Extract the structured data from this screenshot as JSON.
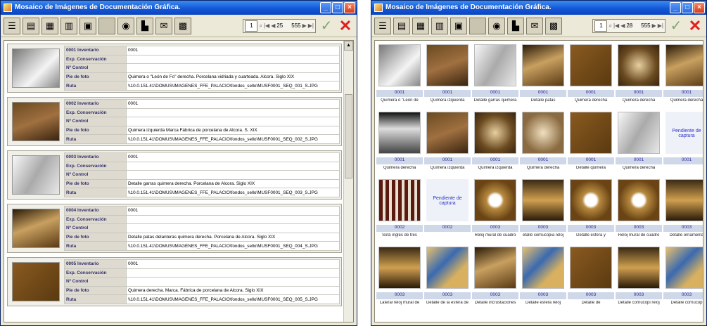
{
  "window_list": {
    "title": "Mosaico de Imágenes de Documentación Gráfica.",
    "nav": {
      "current": "1",
      "count": "25",
      "total": "555"
    },
    "labels": {
      "inventario": "Inventario",
      "conservacion": "Exp. Conservación",
      "control": "Nº Control",
      "pie": "Pie de foto",
      "ruta": "Ruta"
    },
    "records": [
      {
        "num": "0001",
        "inventario": "0001",
        "pie": "Quimera o \"León de Fo\" derecha. Porcelana vidriada y cuarteada. Alcora. Siglo XIX",
        "ruta": "\\\\10.0.151.41\\DOMUS\\IMAGENES_FFE_PALACIO\\fondos_sello\\MUSF0001_SEQ_001_S.JPG"
      },
      {
        "num": "0002",
        "inventario": "0001",
        "pie": "Quimera izquierda Marca Fábrica de porcelana de Alcora. S. XIX",
        "ruta": "\\\\10.0.151.41\\DOMUS\\IMAGENES_FFE_PALACIO\\fondos_sello\\MUSF0001_SEQ_002_S.JPG"
      },
      {
        "num": "0003",
        "inventario": "0001",
        "pie": "Detalle garras quimera derecha. Porcelana de Alcora. Siglo XIX",
        "ruta": "\\\\10.0.151.41\\DOMUS\\IMAGENES_FFE_PALACIO\\fondos_sello\\MUSF0001_SEQ_003_S.JPG"
      },
      {
        "num": "0004",
        "inventario": "0001",
        "pie": "Detalle patas delanteras quimera derecha. Porcelana de Alcora. Siglo XIX",
        "ruta": "\\\\10.0.151.41\\DOMUS\\IMAGENES_FFE_PALACIO\\fondos_sello\\MUSF0001_SEQ_004_S.JPG"
      },
      {
        "num": "0005",
        "inventario": "0001",
        "pie": "Quimera derecha. Marca. Fábrica de porcelana de Alcora. Siglo XIX",
        "ruta": "\\\\10.0.151.41\\DOMUS\\IMAGENES_FFE_PALACIO\\fondos_sello\\MUSF0001_SEQ_005_S.JPG"
      }
    ]
  },
  "window_grid": {
    "title": "Mosaico de Imágenes de Documentación Gráfica.",
    "nav": {
      "current": "1",
      "count": "28",
      "total": "555"
    },
    "pending_label": "Pendiente de captura",
    "cells": [
      {
        "num": "0001",
        "cap": "Quimera o \"León de"
      },
      {
        "num": "0001",
        "cap": "Quimera izquierda"
      },
      {
        "num": "0001",
        "cap": "Detalle garras quimera"
      },
      {
        "num": "0001",
        "cap": "Detalle patas"
      },
      {
        "num": "0001",
        "cap": "Quimera derecha"
      },
      {
        "num": "0001",
        "cap": "Quimera derecha"
      },
      {
        "num": "0001",
        "cap": "Quimera derecha"
      },
      {
        "num": "0001",
        "cap": "Quimera derecha"
      },
      {
        "num": "0001",
        "cap": "Quimera izquierda"
      },
      {
        "num": "0001",
        "cap": "Quimera izquierda"
      },
      {
        "num": "0001",
        "cap": "Quimera derecha"
      },
      {
        "num": "0001",
        "cap": "Detalle quimera"
      },
      {
        "num": "0001",
        "cap": "Quimera derecha"
      },
      {
        "num": "0001",
        "cap": "",
        "pending": true
      },
      {
        "num": "0002",
        "cap": "Sofá inglés de tres"
      },
      {
        "num": "0002",
        "cap": "",
        "pending": true
      },
      {
        "num": "0003",
        "cap": "Reloj mural de cuadro"
      },
      {
        "num": "0003",
        "cap": "etalle cornucopia reloj"
      },
      {
        "num": "0003",
        "cap": "Detalle esfera y"
      },
      {
        "num": "0003",
        "cap": "Reloj mural de cuadro"
      },
      {
        "num": "0003",
        "cap": "Detalle ornamenta"
      },
      {
        "num": "0003",
        "cap": "Lateral reloj mural de"
      },
      {
        "num": "0003",
        "cap": "Detalle de la esfera de"
      },
      {
        "num": "0003",
        "cap": "Detalle incrustaciones"
      },
      {
        "num": "0003",
        "cap": "Detalle esfera reloj"
      },
      {
        "num": "0003",
        "cap": "Detalle de"
      },
      {
        "num": "0003",
        "cap": "Detalle cornucopi reloj"
      },
      {
        "num": "0003",
        "cap": "Detalle cornucop"
      }
    ]
  }
}
